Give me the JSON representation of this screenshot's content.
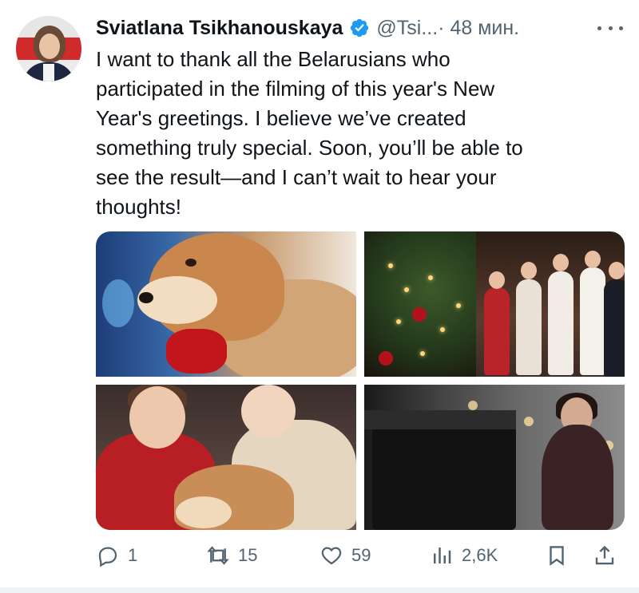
{
  "author": {
    "name": "Sviatlana Tsikhanouskaya",
    "handle": "@Tsi...",
    "time": "· 48 мин.",
    "verified": true
  },
  "tweet": {
    "text": "I want to thank all the Belarusians who\nparticipated in the filming of this year's New\nYear's greetings. I believe we’ve created\nsomething truly special. Soon, you’ll be able to\nsee the result—and I can’t wait to hear your\nthoughts!"
  },
  "actions": {
    "reply_count": "1",
    "retweet_count": "15",
    "like_count": "59",
    "views_count": "2,6K"
  },
  "icons": [
    "verified-badge-icon",
    "more-icon",
    "reply-icon",
    "retweet-icon",
    "like-icon",
    "views-icon",
    "bookmark-icon",
    "share-icon"
  ],
  "colors": {
    "text": "#0f1419",
    "secondary": "#536471",
    "verified": "#1d9bf0"
  }
}
